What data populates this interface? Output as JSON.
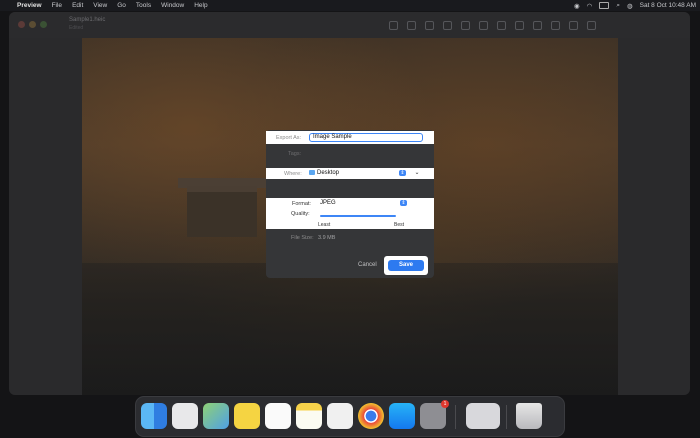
{
  "menubar": {
    "app": "Preview",
    "items": [
      "File",
      "Edit",
      "View",
      "Go",
      "Tools",
      "Window",
      "Help"
    ],
    "datetime": "Sat 8 Oct  10:48 AM"
  },
  "window": {
    "title": "Sample1.heic",
    "subtitle": "Edited"
  },
  "dialog": {
    "export_label": "Export As:",
    "export_value": "Image Sample",
    "tags_label": "Tags:",
    "where_label": "Where:",
    "where_value": "Desktop",
    "format_label": "Format:",
    "format_value": "JPEG",
    "quality_label": "Quality:",
    "quality_value": 0.95,
    "least_label": "Least",
    "best_label": "Best",
    "filesize_label": "File Size:",
    "filesize_value": "3.9 MB",
    "cancel_label": "Cancel",
    "save_label": "Save"
  },
  "colors": {
    "accent": "#2d7af0",
    "focus": "#3d86f6",
    "badge": "#e0382e"
  },
  "dock": {
    "apps": [
      "finder-icon",
      "launchpad-icon",
      "maps-icon",
      "basecamp-icon",
      "reminders-icon",
      "notes-icon",
      "brave-icon",
      "chrome-icon",
      "app-store-icon",
      "system-settings-icon",
      "preview-icon",
      "trash-icon"
    ],
    "settings_badge": "1"
  }
}
